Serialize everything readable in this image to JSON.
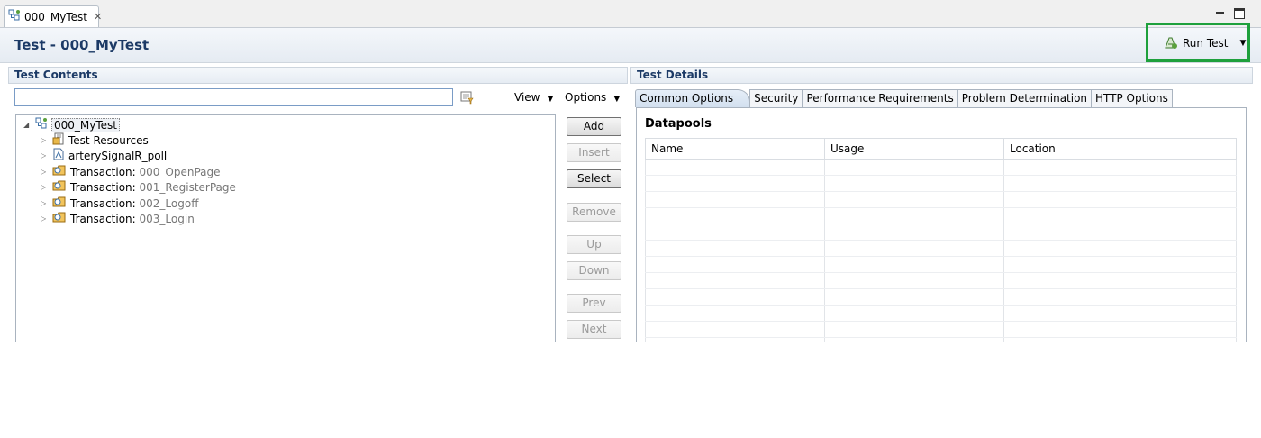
{
  "editor_tab": {
    "label": "000_MyTest"
  },
  "header": {
    "title": "Test - 000_MyTest",
    "run_label": "Run Test"
  },
  "left": {
    "section_title": "Test Contents",
    "filter_value": "",
    "view_label": "View",
    "options_label": "Options",
    "tree": {
      "root": "000_MyTest",
      "children": [
        {
          "label": "Test Resources",
          "detail": ""
        },
        {
          "label": "arterySignalR_poll",
          "detail": ""
        },
        {
          "label": "Transaction:",
          "detail": "000_OpenPage"
        },
        {
          "label": "Transaction:",
          "detail": "001_RegisterPage"
        },
        {
          "label": "Transaction:",
          "detail": "002_Logoff"
        },
        {
          "label": "Transaction:",
          "detail": "003_Login"
        }
      ]
    },
    "buttons": {
      "add": {
        "label": "Add",
        "enabled": true
      },
      "insert": {
        "label": "Insert",
        "enabled": false
      },
      "select": {
        "label": "Select",
        "enabled": true
      },
      "remove": {
        "label": "Remove",
        "enabled": false
      },
      "up": {
        "label": "Up",
        "enabled": false
      },
      "down": {
        "label": "Down",
        "enabled": false
      },
      "prev": {
        "label": "Prev",
        "enabled": false
      },
      "next": {
        "label": "Next",
        "enabled": false
      }
    }
  },
  "right": {
    "section_title": "Test Details",
    "tabs": [
      {
        "label": "Common Options",
        "active": true
      },
      {
        "label": "Security",
        "active": false
      },
      {
        "label": "Performance Requirements",
        "active": false
      },
      {
        "label": "Problem Determination",
        "active": false
      },
      {
        "label": "HTTP Options",
        "active": false
      }
    ],
    "datapools": {
      "title": "Datapools",
      "columns": [
        "Name",
        "Usage",
        "Location"
      ]
    }
  },
  "colors": {
    "highlight": "#1ea03c",
    "title_text": "#1c3a66",
    "disabled_text": "#9a9a9a",
    "folder": "#e8b84a"
  }
}
